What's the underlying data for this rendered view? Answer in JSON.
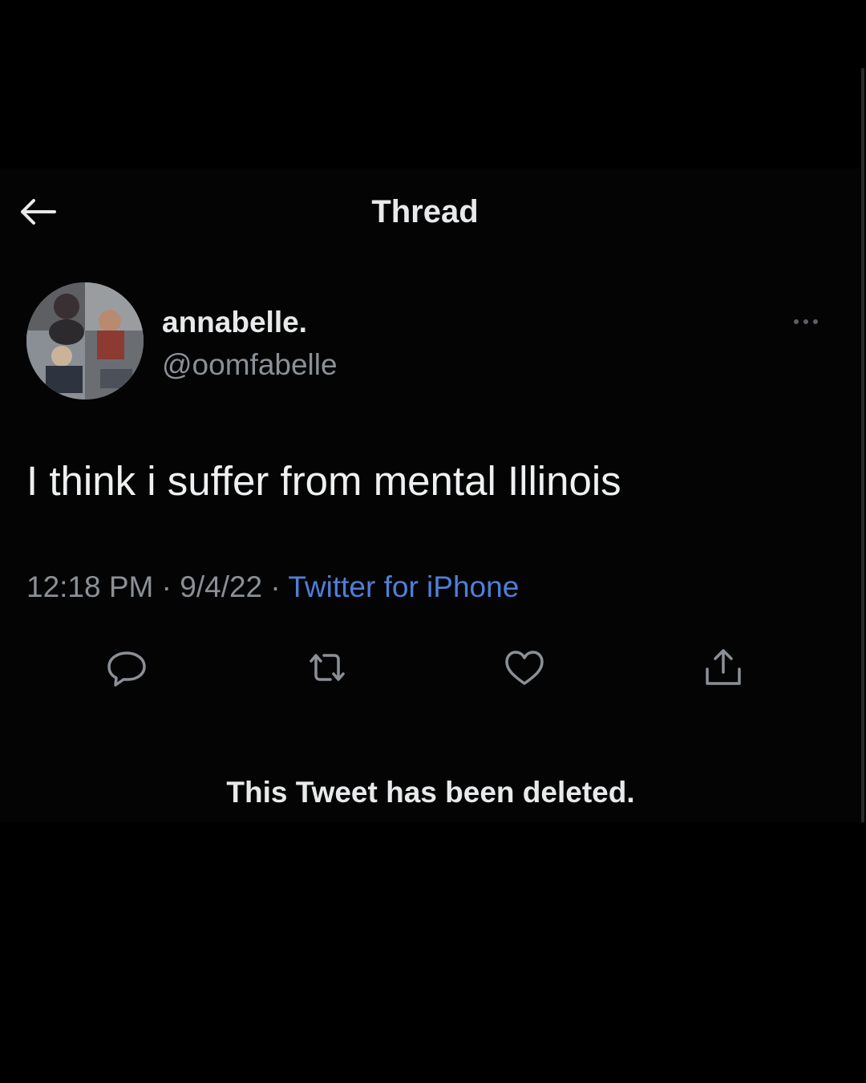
{
  "header": {
    "title": "Thread",
    "back_icon": "arrow-left-icon"
  },
  "author": {
    "display_name": "annabelle.",
    "handle": "@oomfabelle",
    "avatar_icon": "profile-photo-collage"
  },
  "tweet": {
    "text": "I think i suffer from mental Illinois",
    "time": "12:18 PM",
    "date": "9/4/22",
    "separator": " · ",
    "source": "Twitter for iPhone"
  },
  "actions": [
    {
      "name": "reply",
      "icon": "reply-bubble-icon"
    },
    {
      "name": "retweet",
      "icon": "retweet-icon"
    },
    {
      "name": "like",
      "icon": "heart-icon"
    },
    {
      "name": "share",
      "icon": "share-icon"
    }
  ],
  "notice": {
    "deleted": "This Tweet has been deleted."
  },
  "colors": {
    "background": "#000000",
    "text_primary": "#e7e9ea",
    "text_secondary": "#8b9096",
    "link": "#4f7fd8"
  }
}
